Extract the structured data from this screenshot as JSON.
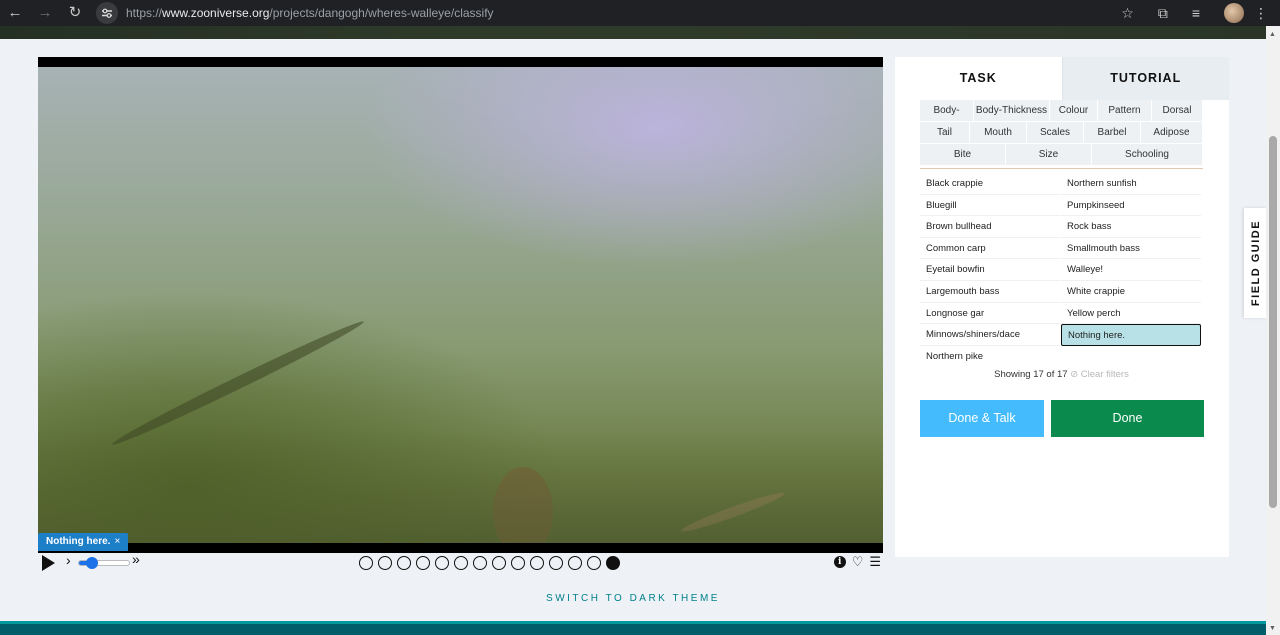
{
  "browser": {
    "url_prefix": "https://",
    "url_domain": "www.zooniverse.org",
    "url_path": "/projects/dangogh/wheres-walleye/classify"
  },
  "icons": {
    "back": "arrow-left-icon",
    "forward": "arrow-right-icon",
    "reload": "reload-icon",
    "star": "star-icon",
    "extensions": "puzzle-icon",
    "media": "playlist-icon",
    "menu": "kebab-icon"
  },
  "viewer": {
    "frame_label": "Nothing here.",
    "frame_label_close": "×",
    "frame_count": 14,
    "active_frame": 14,
    "speed_fraction": 0.25
  },
  "task_panel": {
    "tabs": [
      {
        "label": "TASK",
        "active": true
      },
      {
        "label": "TUTORIAL",
        "active": false
      }
    ],
    "filters": [
      [
        "Body-Shape",
        "Body-Thickness",
        "Colour",
        "Pattern",
        "Dorsal"
      ],
      [
        "Tail",
        "Mouth",
        "Scales",
        "Barbel",
        "Adipose"
      ],
      [
        "Bite",
        "Size",
        "Schooling"
      ]
    ],
    "choices": [
      [
        "Black crappie",
        "Northern sunfish"
      ],
      [
        "Bluegill",
        "Pumpkinseed"
      ],
      [
        "Brown bullhead",
        "Rock bass"
      ],
      [
        "Common carp",
        "Smallmouth bass"
      ],
      [
        "Eyetail bowfin",
        "Walleye!"
      ],
      [
        "Largemouth bass",
        "White crappie"
      ],
      [
        "Longnose gar",
        "Yellow perch"
      ],
      [
        "Minnows/shiners/dace",
        "Nothing here."
      ],
      [
        "Northern pike",
        ""
      ]
    ],
    "selected_choice": "Nothing here.",
    "showing_text": "Showing 17 of 17",
    "clear_filters": "⊘ Clear filters",
    "done_talk_label": "Done & Talk",
    "done_label": "Done"
  },
  "field_guide_label": "FIELD GUIDE",
  "theme_toggle_label": "SWITCH TO DARK THEME",
  "colors": {
    "done_talk": "#43bbfd",
    "done": "#0a8a4c",
    "selected_choice_bg": "#b7e1e6",
    "frame_label_bg": "#1e7fc9",
    "theme_link": "#00828c",
    "footer": "#005d69"
  }
}
